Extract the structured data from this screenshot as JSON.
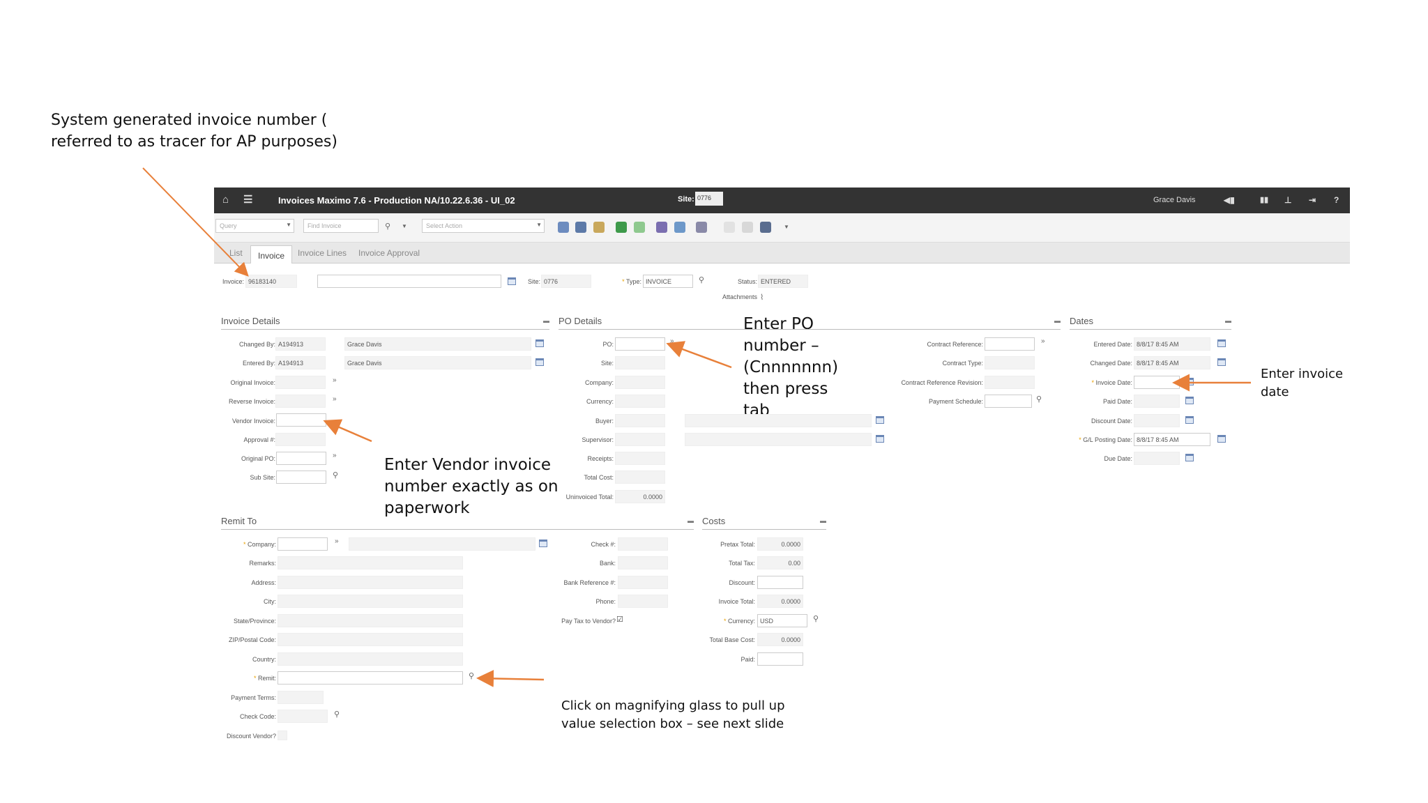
{
  "annotations": {
    "tracer": "System generated invoice number (\nreferred to as tracer for AP purposes)",
    "po": "Enter PO\nnumber –\n(Cnnnnnnn)\nthen press\ntab",
    "vendor": "Enter Vendor invoice\nnumber exactly as on\npaperwork",
    "invoice_date": "Enter invoice\ndate",
    "magnifier": "Click on magnifying glass to pull up\nvalue selection box – see next slide"
  },
  "app": {
    "title": "Invoices Maximo 7.6 - Production NA/10.22.6.36 - UI_02",
    "site_label": "Site:",
    "site_value": "0776",
    "user": "Grace Davis"
  },
  "toolbar": {
    "query_placeholder": "Query",
    "find_placeholder": "Find Invoice",
    "action_placeholder": "Select Action"
  },
  "tabs": [
    "List",
    "Invoice",
    "Invoice Lines",
    "Invoice Approval"
  ],
  "header": {
    "invoice_label": "Invoice:",
    "invoice_value": "96183140",
    "site_label": "Site:",
    "site_value": "0776",
    "type_label": "Type:",
    "type_value": "INVOICE",
    "status_label": "Status:",
    "status_value": "ENTERED",
    "attachments_label": "Attachments"
  },
  "sections": {
    "invoice_details": "Invoice Details",
    "po_details": "PO Details",
    "dates": "Dates",
    "remit_to": "Remit To",
    "costs": "Costs"
  },
  "invoice_details": {
    "changed_by_label": "Changed By:",
    "changed_by": "A194913",
    "changed_by_name": "Grace Davis",
    "entered_by_label": "Entered By:",
    "entered_by": "A194913",
    "entered_by_name": "Grace Davis",
    "original_invoice_label": "Original Invoice:",
    "reverse_invoice_label": "Reverse Invoice:",
    "vendor_invoice_label": "Vendor Invoice:",
    "approval_label": "Approval #:",
    "original_po_label": "Original PO:",
    "sub_site_label": "Sub Site:"
  },
  "po_details": {
    "po_label": "PO:",
    "site_label": "Site:",
    "company_label": "Company:",
    "currency_label": "Currency:",
    "buyer_label": "Buyer:",
    "supervisor_label": "Supervisor:",
    "receipts_label": "Receipts:",
    "total_cost_label": "Total Cost:",
    "uninvoiced_label": "Uninvoiced Total:",
    "uninvoiced_value": "0.0000",
    "contract_ref_label": "Contract Reference:",
    "contract_type_label": "Contract Type:",
    "contract_rev_label": "Contract Reference Revision:",
    "payment_schedule_label": "Payment Schedule:"
  },
  "dates": {
    "entered_label": "Entered Date:",
    "entered_value": "8/8/17 8:45 AM",
    "changed_label": "Changed Date:",
    "changed_value": "8/8/17 8:45 AM",
    "invoice_label": "Invoice Date:",
    "paid_label": "Paid Date:",
    "discount_label": "Discount Date:",
    "gl_label": "G/L Posting Date:",
    "gl_value": "8/8/17 8:45 AM",
    "due_label": "Due Date:"
  },
  "remit": {
    "company_label": "Company:",
    "remarks_label": "Remarks:",
    "address_label": "Address:",
    "city_label": "City:",
    "state_label": "State/Province:",
    "zip_label": "ZIP/Postal Code:",
    "country_label": "Country:",
    "remit_label": "Remit:",
    "payment_terms_label": "Payment Terms:",
    "check_code_label": "Check Code:",
    "discount_vendor_label": "Discount Vendor?",
    "check_label": "Check #:",
    "bank_label": "Bank:",
    "bank_ref_label": "Bank Reference #:",
    "phone_label": "Phone:",
    "pay_tax_label": "Pay Tax to Vendor?"
  },
  "costs": {
    "pretax_label": "Pretax Total:",
    "pretax_value": "0.0000",
    "total_tax_label": "Total Tax:",
    "total_tax_value": "0.00",
    "discount_label": "Discount:",
    "invoice_total_label": "Invoice Total:",
    "invoice_total_value": "0.0000",
    "currency_label": "Currency:",
    "currency_value": "USD",
    "base_cost_label": "Total Base Cost:",
    "base_cost_value": "0.0000",
    "paid_label": "Paid:"
  },
  "colors": {
    "arrow": "#e8803a",
    "topbar": "#333333"
  }
}
